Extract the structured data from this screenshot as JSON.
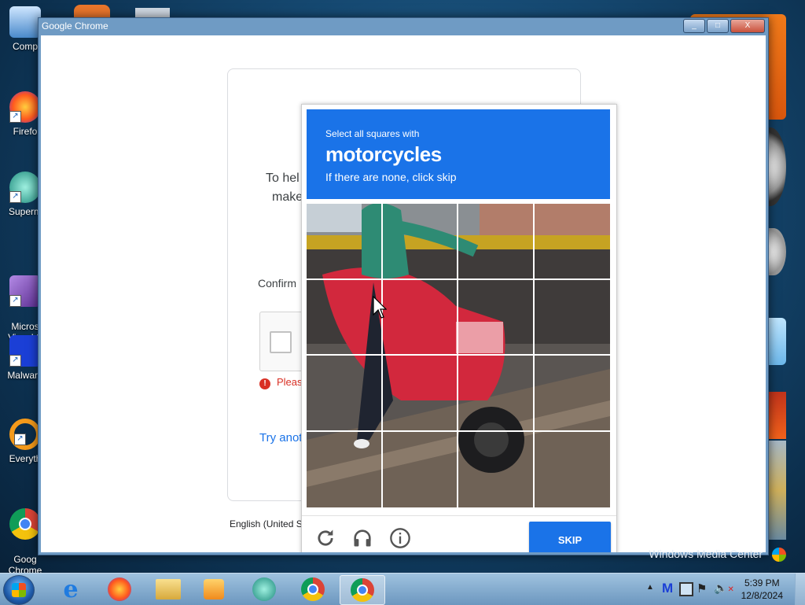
{
  "desktop": {
    "icons": [
      {
        "label": "Comp",
        "icon": "computer-icon"
      },
      {
        "label": "Firefo",
        "icon": "firefox-icon"
      },
      {
        "label": "Superm",
        "icon": "supermium-icon"
      },
      {
        "label": "Micros\nVisual S",
        "icon": "visual-studio-icon"
      },
      {
        "label": "Malware",
        "icon": "malwarebytes-icon"
      },
      {
        "label": "Everyth",
        "icon": "everything-icon"
      },
      {
        "label": "Goog\nChrome",
        "icon": "chrome-icon"
      }
    ]
  },
  "window": {
    "title": "Google Chrome",
    "minimize": "_",
    "maximize": "□",
    "close": "X"
  },
  "google_page": {
    "text_line1": "To hel",
    "text_line2": "make",
    "confirm": "Confirm",
    "error": "Pleas",
    "try_another": "Try anot",
    "language": "English (United S"
  },
  "captcha": {
    "instruction": "Select all squares with",
    "target": "motorcycles",
    "subtext": "If there are none, click skip",
    "skip_label": "SKIP",
    "footer_icons": [
      "reload-icon",
      "audio-headphones-icon",
      "info-icon"
    ]
  },
  "wmc_label": "Windows Media Center",
  "taskbar": {
    "apps": [
      "internet-explorer-icon",
      "firefox-icon",
      "file-explorer-icon",
      "media-player-icon",
      "supermium-icon",
      "chrome-icon",
      "chrome-icon"
    ],
    "time": "5:39 PM",
    "date": "12/8/2024"
  },
  "colors": {
    "captcha_blue": "#1a73e8",
    "error_red": "#d93025"
  }
}
